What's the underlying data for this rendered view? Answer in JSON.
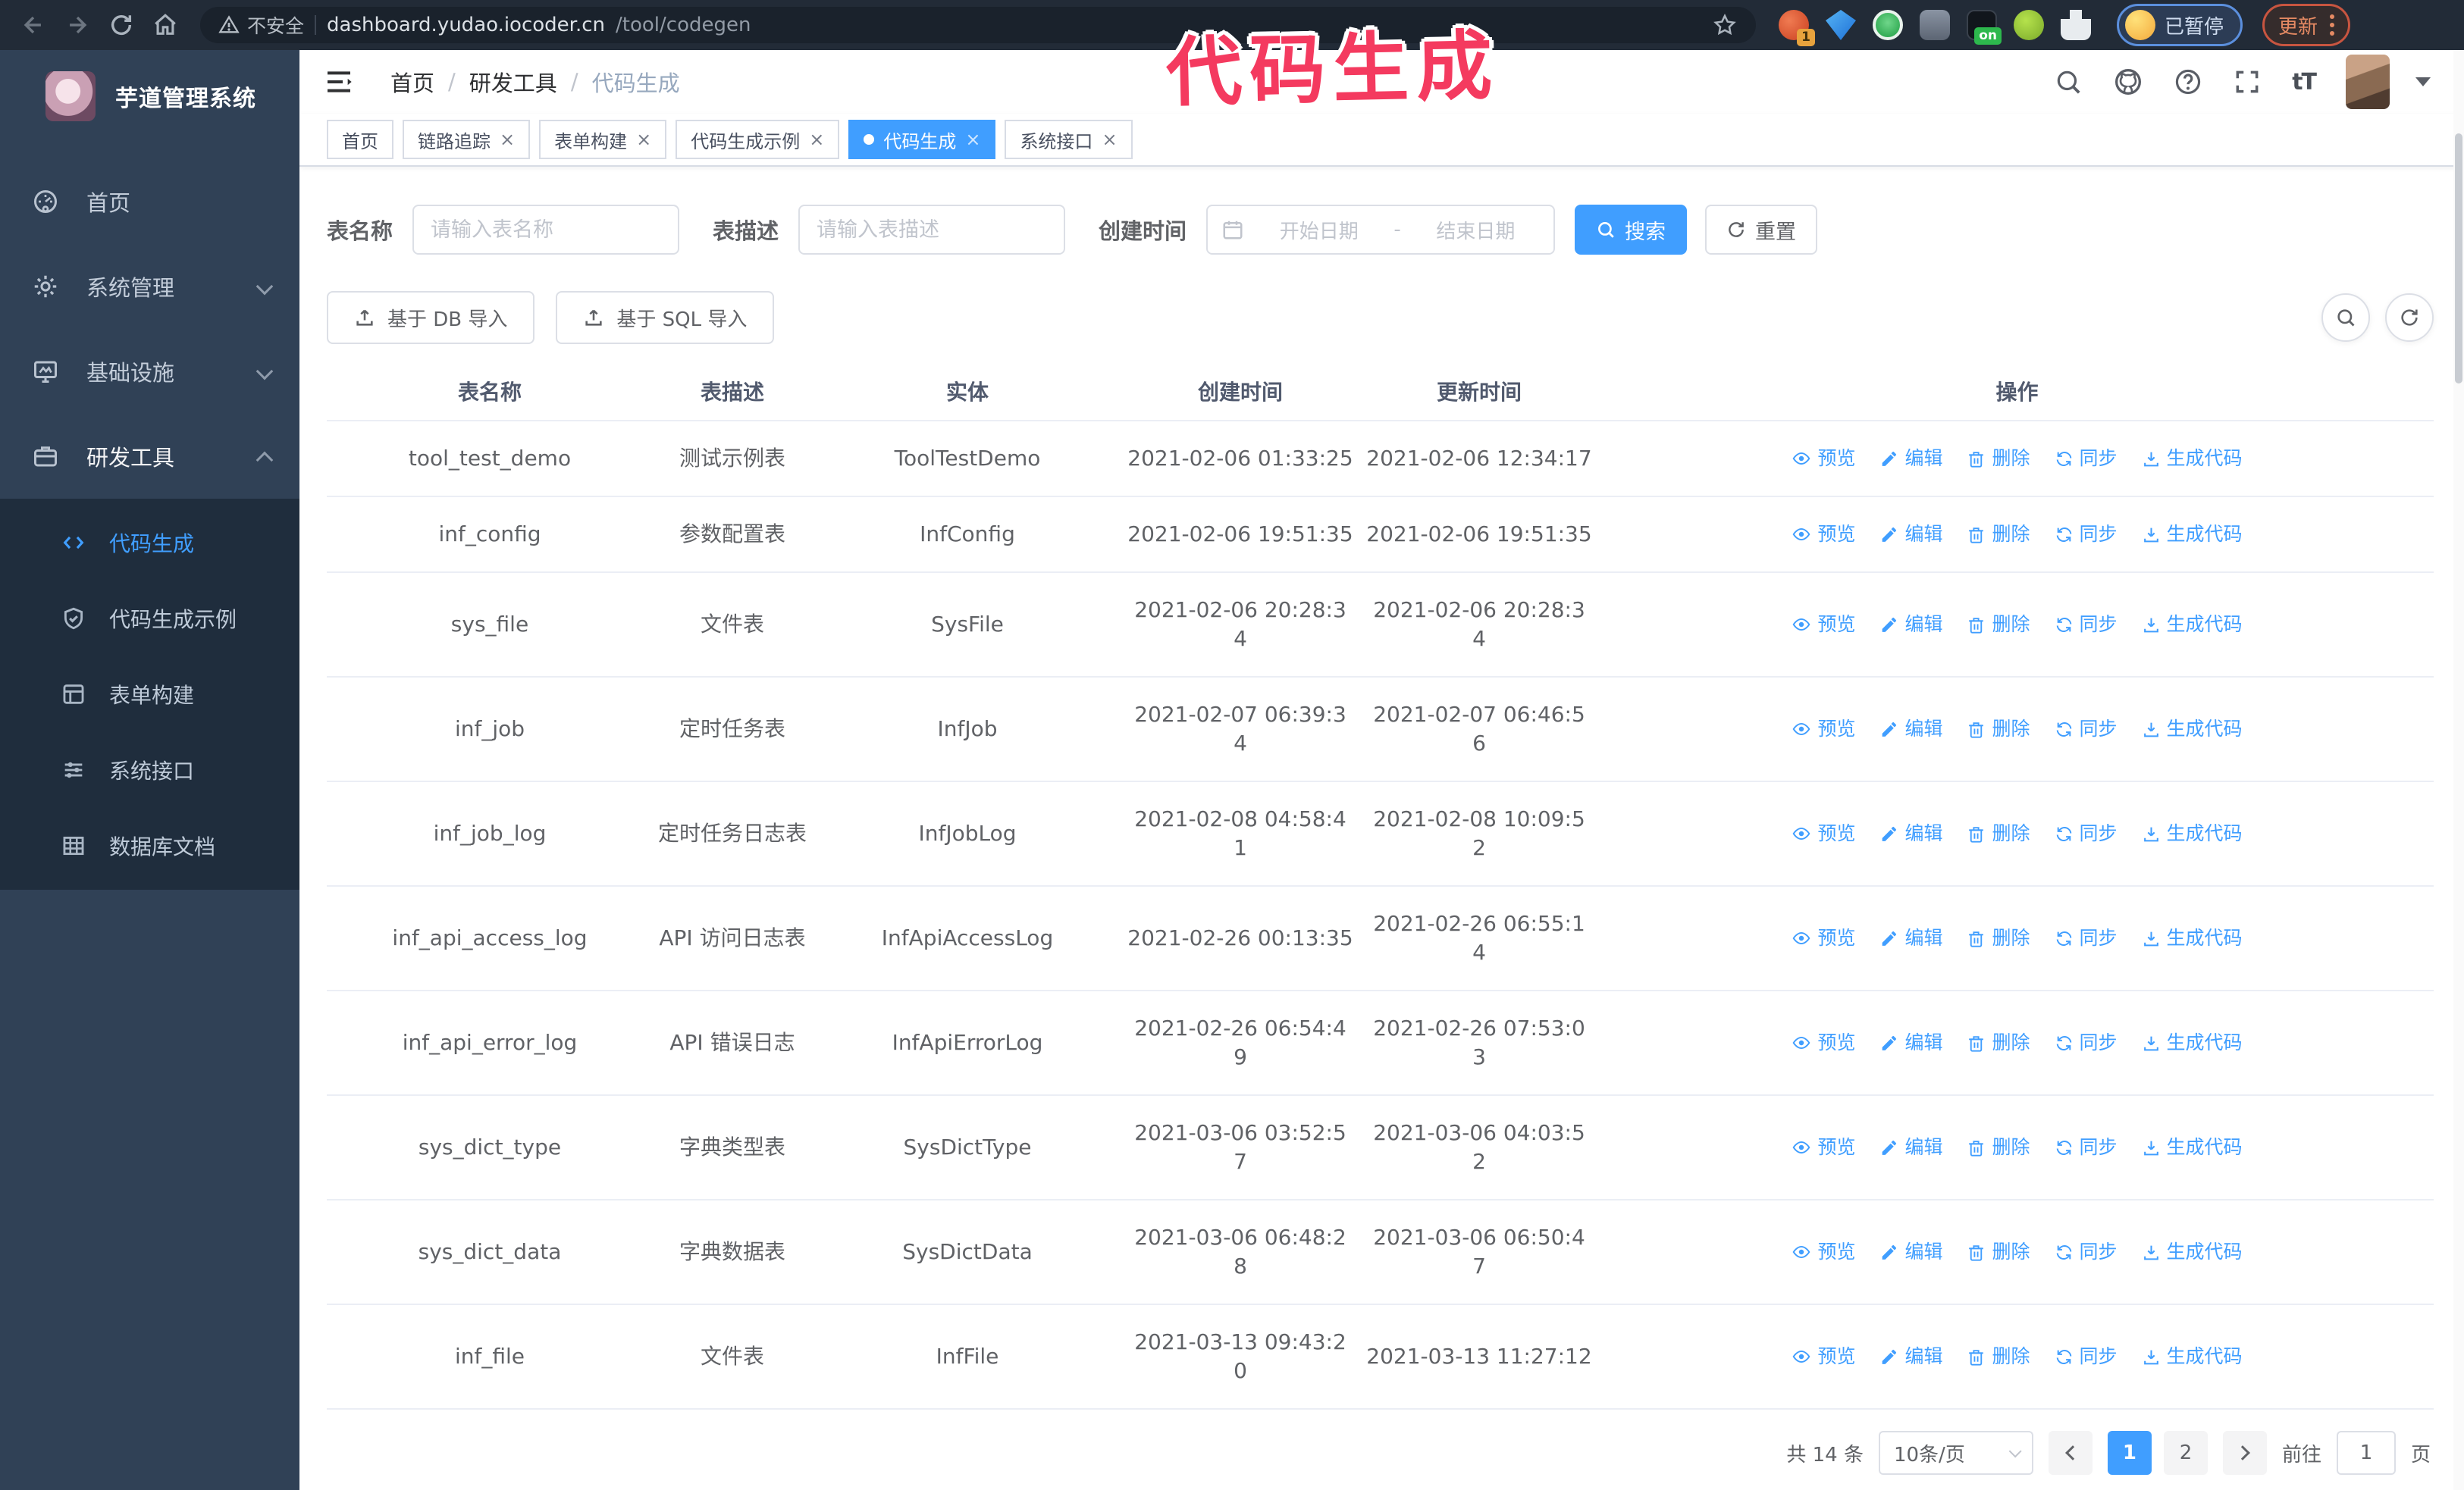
{
  "browser": {
    "security_warning": "不安全",
    "url_host": "dashboard.yudao.iocoder.cn",
    "url_path": "/tool/codegen",
    "extensions": [
      {
        "name": "extension-orange",
        "badge": "1"
      },
      {
        "name": "extension-gem",
        "badge": ""
      },
      {
        "name": "extension-green-check",
        "badge": ""
      },
      {
        "name": "extension-grid",
        "badge": ""
      },
      {
        "name": "extension-dark",
        "badge": "on"
      },
      {
        "name": "extension-android",
        "badge": ""
      },
      {
        "name": "extension-puzzle",
        "badge": ""
      }
    ],
    "profile_status": "已暂停",
    "update_label": "更新"
  },
  "annotation": {
    "text": "代码生成",
    "color": "#f43a5f"
  },
  "sidebar": {
    "title": "芋道管理系统",
    "items": [
      {
        "key": "home",
        "label": "首页",
        "icon": "dashboard-icon",
        "expandable": false,
        "expanded": false
      },
      {
        "key": "system",
        "label": "系统管理",
        "icon": "gear-icon",
        "expandable": true,
        "expanded": false
      },
      {
        "key": "infra",
        "label": "基础设施",
        "icon": "monitor-icon",
        "expandable": true,
        "expanded": false
      },
      {
        "key": "devtools",
        "label": "研发工具",
        "icon": "briefcase-icon",
        "expandable": true,
        "expanded": true
      }
    ],
    "submenu": [
      {
        "key": "codegen",
        "label": "代码生成",
        "icon": "code-icon",
        "active": true
      },
      {
        "key": "codegen-example",
        "label": "代码生成示例",
        "icon": "shield-check-icon",
        "active": false
      },
      {
        "key": "form-builder",
        "label": "表单构建",
        "icon": "form-icon",
        "active": false
      },
      {
        "key": "system-api",
        "label": "系统接口",
        "icon": "sliders-icon",
        "active": false
      },
      {
        "key": "db-doc",
        "label": "数据库文档",
        "icon": "table-grid-icon",
        "active": false
      }
    ]
  },
  "header": {
    "breadcrumb": [
      "首页",
      "研发工具",
      "代码生成"
    ],
    "font_icon_label": "tT"
  },
  "tabs": [
    {
      "label": "首页",
      "closable": false,
      "active": false
    },
    {
      "label": "链路追踪",
      "closable": true,
      "active": false
    },
    {
      "label": "表单构建",
      "closable": true,
      "active": false
    },
    {
      "label": "代码生成示例",
      "closable": true,
      "active": false
    },
    {
      "label": "代码生成",
      "closable": true,
      "active": true
    },
    {
      "label": "系统接口",
      "closable": true,
      "active": false
    }
  ],
  "filters": {
    "table_name_label": "表名称",
    "table_name_placeholder": "请输入表名称",
    "table_desc_label": "表描述",
    "table_desc_placeholder": "请输入表描述",
    "create_time_label": "创建时间",
    "date_start_placeholder": "开始日期",
    "date_separator": "-",
    "date_end_placeholder": "结束日期",
    "search_label": "搜索",
    "reset_label": "重置"
  },
  "toolbar": {
    "import_db_label": "基于 DB 导入",
    "import_sql_label": "基于 SQL 导入"
  },
  "table": {
    "columns": [
      "表名称",
      "表描述",
      "实体",
      "创建时间",
      "更新时间",
      "操作"
    ],
    "actions": [
      {
        "label": "预览",
        "icon": "eye-icon"
      },
      {
        "label": "编辑",
        "icon": "edit-icon"
      },
      {
        "label": "删除",
        "icon": "delete-icon"
      },
      {
        "label": "同步",
        "icon": "sync-icon"
      },
      {
        "label": "生成代码",
        "icon": "generate-code-icon"
      }
    ],
    "rows": [
      {
        "name": "tool_test_demo",
        "desc": "测试示例表",
        "entity": "ToolTestDemo",
        "created": "2021-02-06 01:33:25",
        "updated": "2021-02-06 12:34:17"
      },
      {
        "name": "inf_config",
        "desc": "参数配置表",
        "entity": "InfConfig",
        "created": "2021-02-06 19:51:35",
        "updated": "2021-02-06 19:51:35"
      },
      {
        "name": "sys_file",
        "desc": "文件表",
        "entity": "SysFile",
        "created": "2021-02-06 20:28:3\n4",
        "updated": "2021-02-06 20:28:3\n4"
      },
      {
        "name": "inf_job",
        "desc": "定时任务表",
        "entity": "InfJob",
        "created": "2021-02-07 06:39:3\n4",
        "updated": "2021-02-07 06:46:5\n6"
      },
      {
        "name": "inf_job_log",
        "desc": "定时任务日志表",
        "entity": "InfJobLog",
        "created": "2021-02-08 04:58:4\n1",
        "updated": "2021-02-08 10:09:5\n2"
      },
      {
        "name": "inf_api_access_log",
        "desc": "API 访问日志表",
        "entity": "InfApiAccessLog",
        "created": "2021-02-26 00:13:35",
        "updated": "2021-02-26 06:55:1\n4"
      },
      {
        "name": "inf_api_error_log",
        "desc": "API 错误日志",
        "entity": "InfApiErrorLog",
        "created": "2021-02-26 06:54:4\n9",
        "updated": "2021-02-26 07:53:0\n3"
      },
      {
        "name": "sys_dict_type",
        "desc": "字典类型表",
        "entity": "SysDictType",
        "created": "2021-03-06 03:52:5\n7",
        "updated": "2021-03-06 04:03:5\n2"
      },
      {
        "name": "sys_dict_data",
        "desc": "字典数据表",
        "entity": "SysDictData",
        "created": "2021-03-06 06:48:2\n8",
        "updated": "2021-03-06 06:50:4\n7"
      },
      {
        "name": "inf_file",
        "desc": "文件表",
        "entity": "InfFile",
        "created": "2021-03-13 09:43:2\n0",
        "updated": "2021-03-13 11:27:12"
      }
    ]
  },
  "pagination": {
    "total": "共 14 条",
    "page_size": "10条/页",
    "pages": [
      "1",
      "2"
    ],
    "active_page": "1",
    "goto_label": "前往",
    "goto_value": "1",
    "page_unit": "页"
  }
}
